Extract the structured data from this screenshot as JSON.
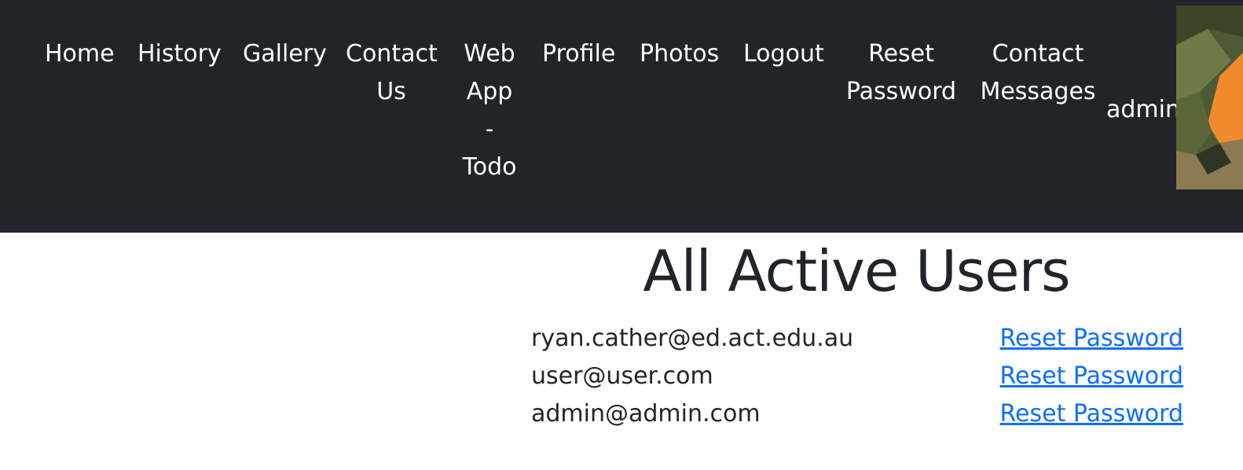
{
  "nav": {
    "items": [
      {
        "label": "Home"
      },
      {
        "label": "History"
      },
      {
        "label": "Gallery"
      },
      {
        "lines": [
          "Contact",
          "Us"
        ]
      },
      {
        "lines": [
          "Web",
          "App",
          "-",
          "Todo"
        ]
      },
      {
        "label": "Profile"
      },
      {
        "label": "Photos"
      },
      {
        "label": "Logout"
      },
      {
        "lines": [
          "Reset",
          "Password"
        ]
      },
      {
        "lines": [
          "Contact",
          "Messages"
        ]
      }
    ],
    "username": "admin",
    "avatar_colors": {
      "bg": "#4c5a36",
      "accent": "#f08a2c",
      "dark": "#2f3323",
      "light": "#8c7a55"
    }
  },
  "page": {
    "title": "All Active Users"
  },
  "users": [
    {
      "email": "ryan.cather@ed.act.edu.au",
      "action": "Reset Password"
    },
    {
      "email": "user@user.com",
      "action": "Reset Password"
    },
    {
      "email": "admin@admin.com",
      "action": "Reset Password"
    }
  ],
  "colors": {
    "navbar_bg": "#212529",
    "link": "#0d6efd",
    "text": "#212529"
  }
}
